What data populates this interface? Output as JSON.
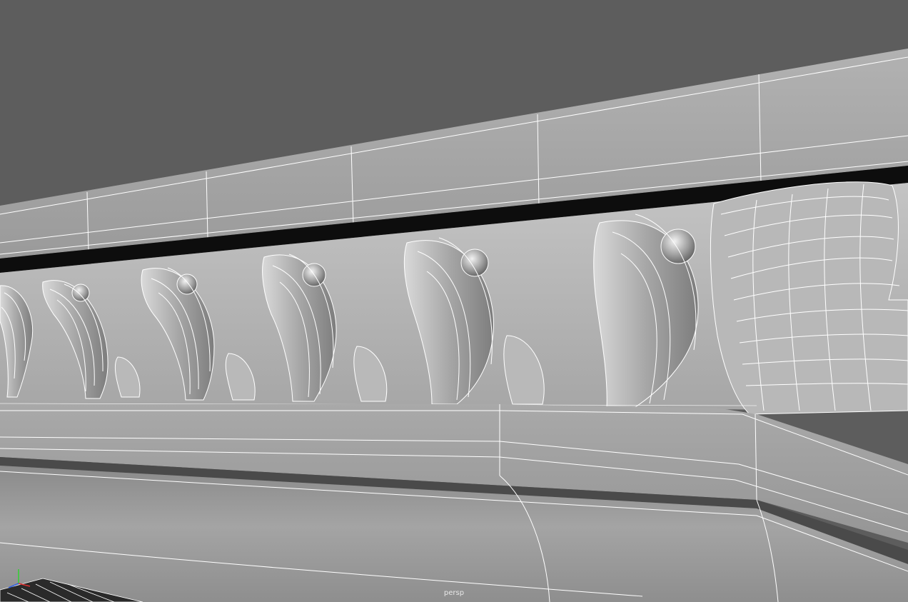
{
  "viewport": {
    "camera_name": "persp",
    "background_color": "#5d5d5d",
    "wireframe_color": "#ffffff",
    "shading_mode": "smooth-shaded-with-wireframe"
  },
  "axis_gizmo": {
    "x_color": "#e03030",
    "y_color": "#30d030",
    "z_color": "#3060e0"
  }
}
